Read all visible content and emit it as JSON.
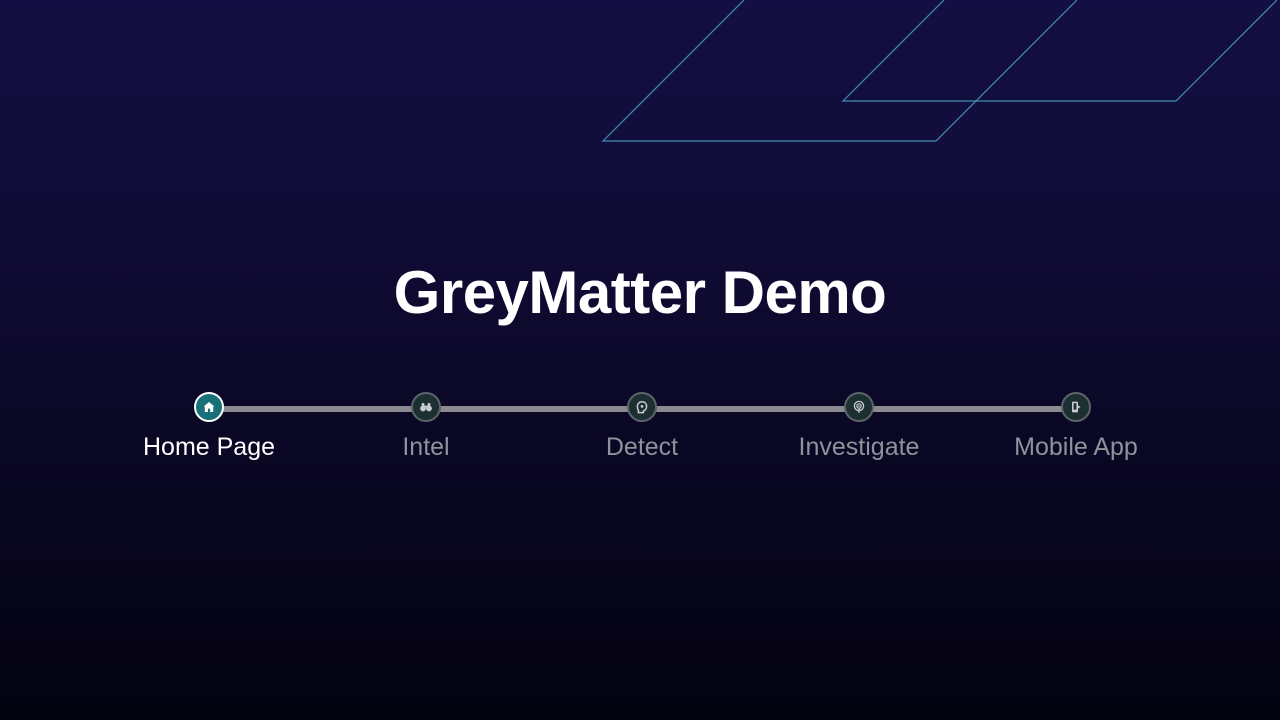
{
  "title": "GreyMatter Demo",
  "steps": [
    {
      "label": "Home Page",
      "icon": "home-icon",
      "active": true
    },
    {
      "label": "Intel",
      "icon": "binoculars-icon",
      "active": false
    },
    {
      "label": "Detect",
      "icon": "bell-shield-icon",
      "active": false
    },
    {
      "label": "Investigate",
      "icon": "radar-icon",
      "active": false
    },
    {
      "label": "Mobile App",
      "icon": "mobile-app-icon",
      "active": false
    }
  ],
  "colors": {
    "background_top": "#140f42",
    "background_bottom": "#040310",
    "active_node": "#187079",
    "track": "#8a8a90",
    "decor_line": "#4aa3c8"
  }
}
